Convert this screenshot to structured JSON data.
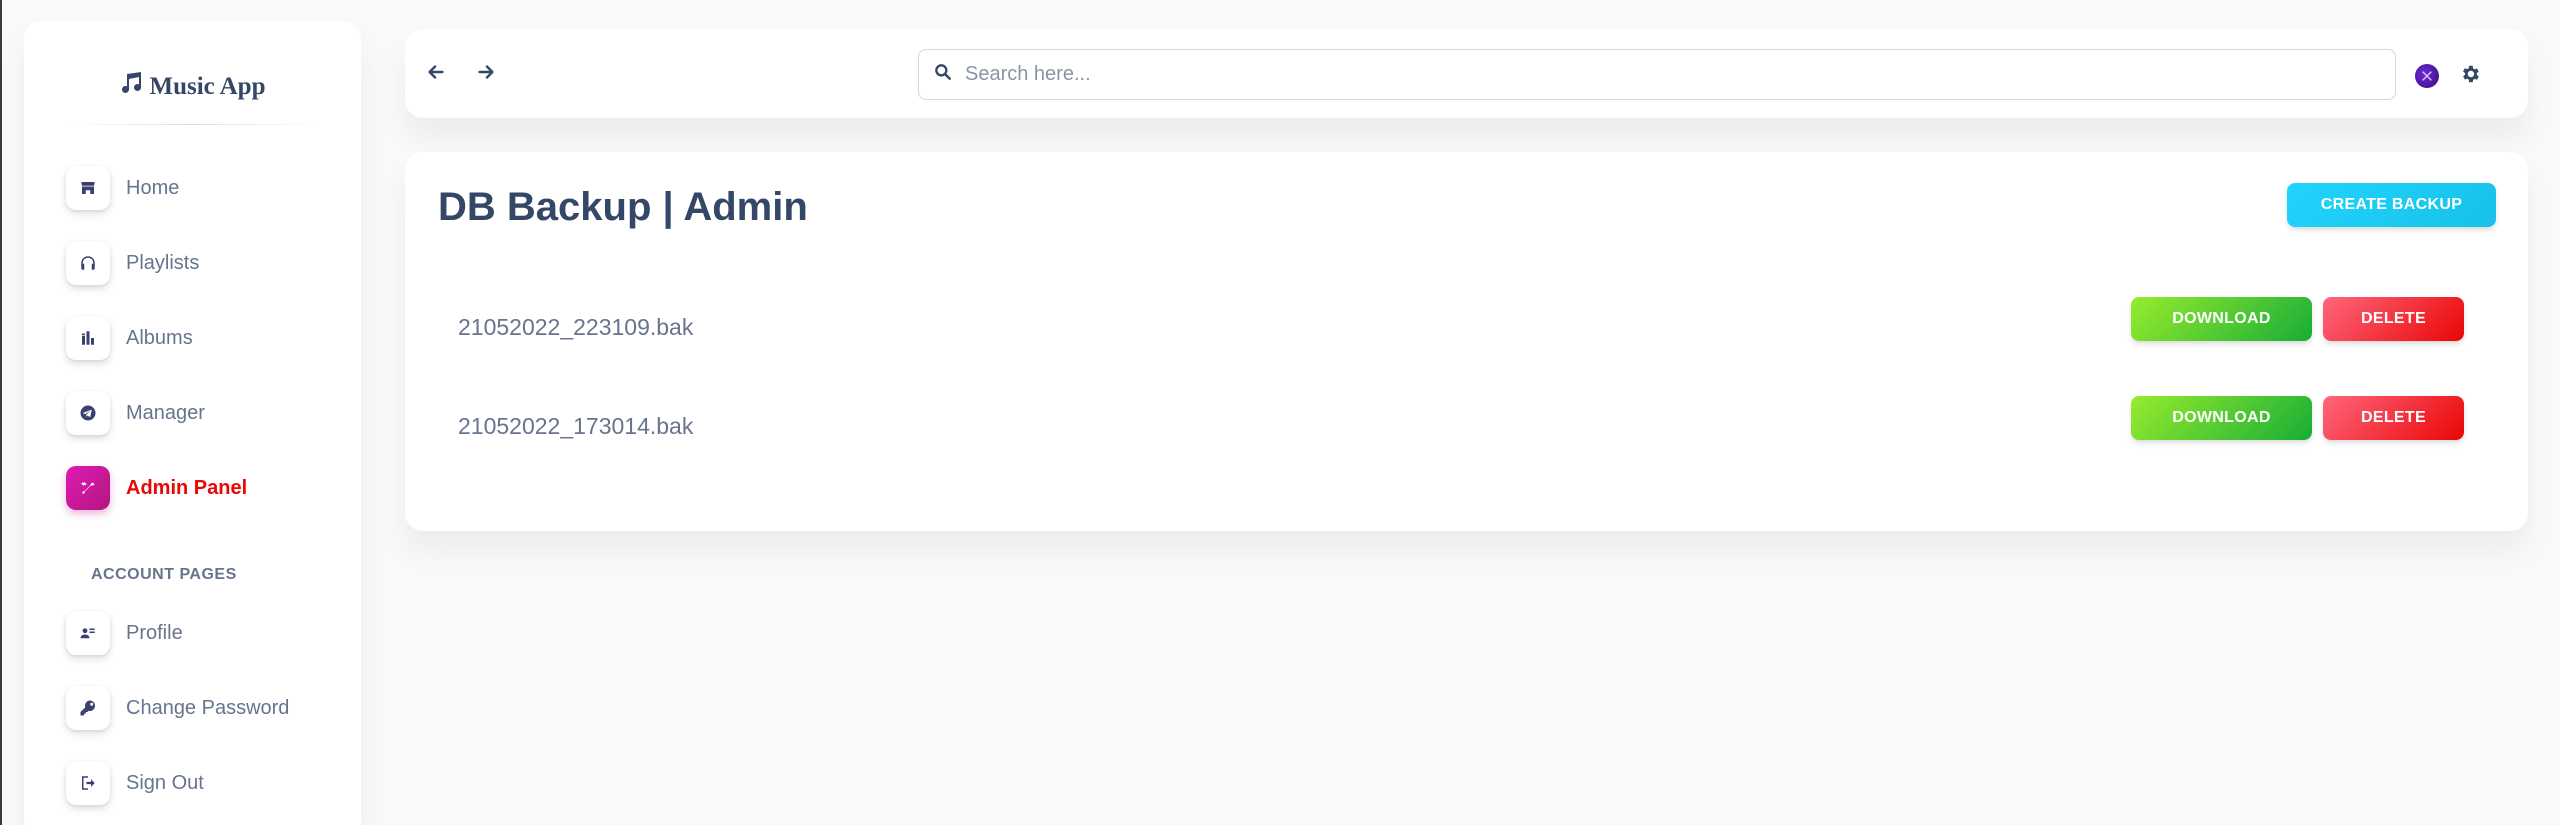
{
  "brand": {
    "name": "Music App",
    "icon": "music-note-icon"
  },
  "sidebar": {
    "items": [
      {
        "label": "Home",
        "icon": "shop-icon",
        "active": false
      },
      {
        "label": "Playlists",
        "icon": "headphones-icon",
        "active": false
      },
      {
        "label": "Albums",
        "icon": "albums-icon",
        "active": false
      },
      {
        "label": "Manager",
        "icon": "telegram-icon",
        "active": false
      },
      {
        "label": "Admin Panel",
        "icon": "tools-icon",
        "active": true
      }
    ],
    "section_heading": "ACCOUNT PAGES",
    "account_items": [
      {
        "label": "Profile",
        "icon": "user-card-icon"
      },
      {
        "label": "Change Password",
        "icon": "key-icon"
      },
      {
        "label": "Sign Out",
        "icon": "sign-out-icon"
      }
    ]
  },
  "topbar": {
    "back_icon": "arrow-left-icon",
    "forward_icon": "arrow-right-icon",
    "search_placeholder": "Search here...",
    "avatar_icon": "avatar-icon",
    "settings_icon": "gear-icon"
  },
  "main": {
    "title": "DB Backup | Admin",
    "create_label": "CREATE BACKUP",
    "backups": [
      {
        "file": "21052022_223109.bak",
        "download_label": "DOWNLOAD",
        "delete_label": "DELETE"
      },
      {
        "file": "21052022_173014.bak",
        "download_label": "DOWNLOAD",
        "delete_label": "DELETE"
      }
    ]
  },
  "colors": {
    "accent_active": "#ea0606",
    "active_icon_bg": "#cb0c9f",
    "create_button": "#17c1e8",
    "download_button": "#17ad37",
    "delete_button": "#ea0606",
    "text_dark": "#344767",
    "text_muted": "#67748e"
  }
}
